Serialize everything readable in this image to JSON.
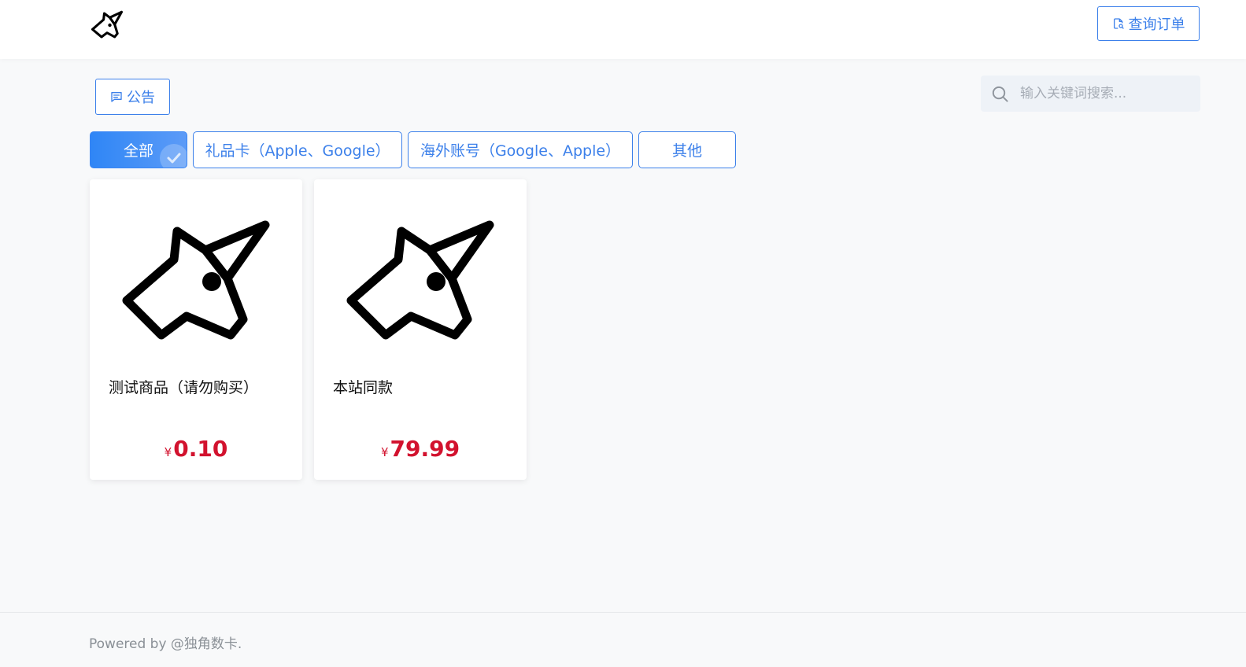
{
  "header": {
    "logo_icon": "unicorn-logo-icon",
    "order_button": {
      "icon": "document-search-icon",
      "label": "查询订单"
    }
  },
  "toolbar": {
    "notice_button": {
      "icon": "message-square-icon",
      "label": "公告"
    },
    "search": {
      "icon": "search-icon",
      "placeholder": "输入关键词搜索..."
    }
  },
  "categories": [
    {
      "label": "全部",
      "active": true
    },
    {
      "label": "礼品卡（Apple、Google）",
      "active": false
    },
    {
      "label": "海外账号（Google、Apple）",
      "active": false
    },
    {
      "label": "其他",
      "active": false
    }
  ],
  "products": [
    {
      "name": "测试商品（请勿购买）",
      "currency": "¥",
      "price": "0.10",
      "image_icon": "unicorn-icon"
    },
    {
      "name": "本站同款",
      "currency": "¥",
      "price": "79.99",
      "image_icon": "unicorn-icon"
    }
  ],
  "footer": {
    "text": "Powered by @独角数卡."
  },
  "colors": {
    "accent": "#3c80ea",
    "price": "#d2122e",
    "background": "#f8f9fa"
  }
}
